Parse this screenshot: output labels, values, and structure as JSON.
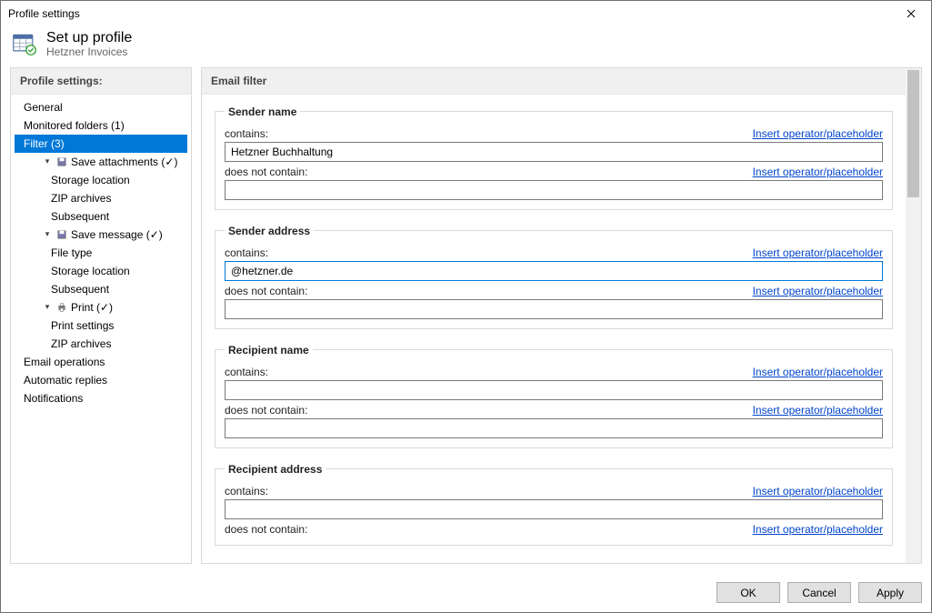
{
  "window": {
    "title": "Profile settings"
  },
  "header": {
    "title": "Set up profile",
    "subtitle": "Hetzner Invoices"
  },
  "sidebar": {
    "title": "Profile settings:",
    "items": {
      "general": "General",
      "monitored": "Monitored folders (1)",
      "filter": "Filter (3)",
      "save_attachments": "Save attachments (✓)",
      "storage_location_1": "Storage location",
      "zip_archives_1": "ZIP archives",
      "subsequent_1": "Subsequent",
      "save_message": "Save message (✓)",
      "file_type": "File type",
      "storage_location_2": "Storage location",
      "subsequent_2": "Subsequent",
      "print": "Print  (✓)",
      "print_settings": "Print settings",
      "zip_archives_2": "ZIP archives",
      "email_ops": "Email operations",
      "auto_replies": "Automatic replies",
      "notifications": "Notifications"
    }
  },
  "content": {
    "title": "Email filter",
    "insert_link": "Insert operator/placeholder",
    "labels": {
      "contains": "contains:",
      "not_contain": "does not contain:"
    },
    "groups": {
      "sender_name": {
        "legend": "Sender name",
        "contains_value": "Hetzner Buchhaltung",
        "not_value": ""
      },
      "sender_address": {
        "legend": "Sender address",
        "contains_value": "@hetzner.de",
        "not_value": ""
      },
      "recipient_name": {
        "legend": "Recipient name",
        "contains_value": "",
        "not_value": ""
      },
      "recipient_address": {
        "legend": "Recipient address",
        "contains_value": "",
        "not_value": ""
      }
    }
  },
  "buttons": {
    "ok": "OK",
    "cancel": "Cancel",
    "apply": "Apply"
  }
}
